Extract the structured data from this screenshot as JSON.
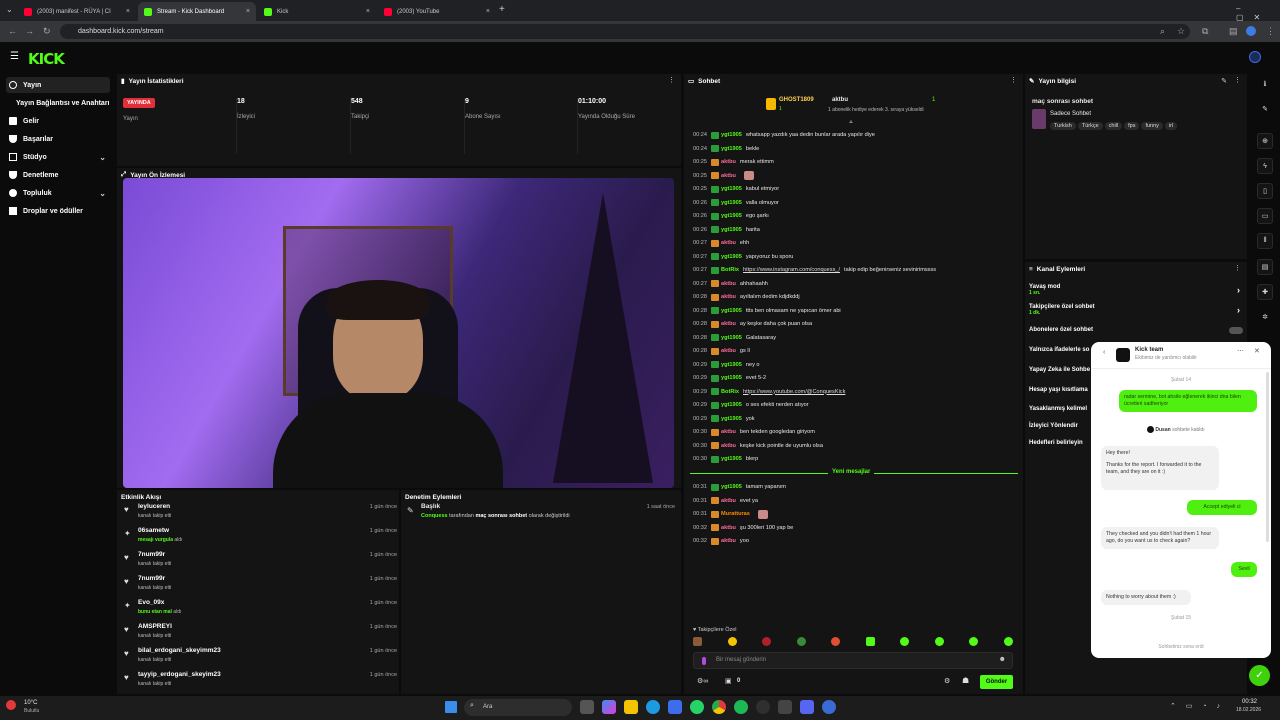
{
  "browser": {
    "tabs": [
      {
        "title": "(2003) manifest - RÜYA | CI",
        "color": "#ff0033"
      },
      {
        "title": "Stream - Kick Dashboard",
        "color": "#53fc18"
      },
      {
        "title": "Kick",
        "color": "#53fc18"
      },
      {
        "title": "(2003) YouTube",
        "color": "#ff0033"
      }
    ],
    "new_tab": "+",
    "url": "dashboard.kick.com/stream"
  },
  "logo": "KICK",
  "sidebar": {
    "items": [
      {
        "label": "Yayın",
        "icon": "broadcast-icon"
      },
      {
        "label": "Yayın Bağlantısı ve Anahtarı",
        "icon": ""
      },
      {
        "label": "Gelir",
        "icon": "money-icon"
      },
      {
        "label": "Başarılar",
        "icon": "trophy-icon"
      },
      {
        "label": "Stüdyo",
        "icon": "studio-icon",
        "chevron": "⌄"
      },
      {
        "label": "Denetleme",
        "icon": "shield-icon"
      },
      {
        "label": "Topluluk",
        "icon": "community-icon",
        "chevron": "⌄"
      },
      {
        "label": "Droplar ve ödüller",
        "icon": "gift-icon"
      }
    ]
  },
  "stats": {
    "title": "Yayın İstatistikleri",
    "live_badge": "YAYINDA",
    "items": [
      {
        "value": "",
        "label": "Yayın"
      },
      {
        "value": "18",
        "label": "İzleyici"
      },
      {
        "value": "548",
        "label": "Takipçi"
      },
      {
        "value": "9",
        "label": "Abone Sayısı"
      },
      {
        "value": "01:10:00",
        "label": "Yayında Olduğu Süre"
      }
    ]
  },
  "preview": {
    "title": "Yayın Ön İzlemesi"
  },
  "activity": {
    "title": "Etkinlik Akışı",
    "items": [
      {
        "name": "leyluceren",
        "desc": "kanalı takip etti",
        "time": "1 gün önce",
        "icon": "♥"
      },
      {
        "name": "06sametw",
        "desc": "mesajı vurgula",
        "desc2": "aldı",
        "time": "1 gün önce",
        "icon": "✦"
      },
      {
        "name": "7num99r",
        "desc": "kanalı takip etti",
        "time": "1 gün önce",
        "icon": "♥"
      },
      {
        "name": "7num99r",
        "desc": "kanalı takip etti",
        "time": "1 gün önce",
        "icon": "♥"
      },
      {
        "name": "Evo_09x",
        "desc": "bunu etan mal",
        "desc2": "aldı",
        "time": "1 gün önce",
        "icon": "✦"
      },
      {
        "name": "AMSPREYI",
        "desc": "kanalı takip etti",
        "time": "1 gün önce",
        "icon": "♥"
      },
      {
        "name": "bilal_erdogani_skeyimm23",
        "desc": "kanalı takip etti",
        "time": "1 gün önce",
        "icon": "♥"
      },
      {
        "name": "tayyip_erdogani_skeyim23",
        "desc": "kanalı takip etti",
        "time": "1 gün önce",
        "icon": "♥"
      }
    ]
  },
  "moderation": {
    "title": "Denetim Eylemleri",
    "item": {
      "title": "Başlık",
      "actor": "Conquess",
      "text1": "tarafından",
      "bold": "maç sonrası sohbet",
      "text2": "olarak değiştirildi",
      "time": "1 saat önce"
    }
  },
  "chat": {
    "title": "Sohbet",
    "gifter": "GHOST1809",
    "gifter_count": "1",
    "gift_to": "aktbu",
    "gift_count": "1",
    "gift_msg": "1 abonelik hediye ederek 3. sıraya yükseldi",
    "messages": [
      {
        "t": "00:24",
        "u": "ygt1905",
        "c": "#53fc18",
        "m": "whatsapp yazdık yaa dedin bunlar arada yapılır diye"
      },
      {
        "t": "00:24",
        "u": "ygt1905",
        "c": "#53fc18",
        "m": "bekle"
      },
      {
        "t": "00:25",
        "u": "aktbu",
        "c": "#ff6a9a",
        "m": "merak ettimm"
      },
      {
        "t": "00:25",
        "u": "aktbu",
        "c": "#ff6a9a",
        "m": ""
      },
      {
        "t": "00:25",
        "u": "ygt1905",
        "c": "#53fc18",
        "m": "kabul etmiyor"
      },
      {
        "t": "00:26",
        "u": "ygt1905",
        "c": "#53fc18",
        "m": "valla olmuyor"
      },
      {
        "t": "00:26",
        "u": "ygt1905",
        "c": "#53fc18",
        "m": "ego şarkı"
      },
      {
        "t": "00:26",
        "u": "ygt1905",
        "c": "#53fc18",
        "m": "harita"
      },
      {
        "t": "00:27",
        "u": "aktbu",
        "c": "#ff6a9a",
        "m": "ehh"
      },
      {
        "t": "00:27",
        "u": "ygt1905",
        "c": "#53fc18",
        "m": "yapıyoruz bu sporu"
      },
      {
        "t": "00:27",
        "u": "BotRix",
        "c": "#53fc18",
        "m": "https://www.instagram.com/conquess_/",
        "m2": "takip edip beğenirseniz sevinirimssss"
      },
      {
        "t": "00:27",
        "u": "aktbu",
        "c": "#ff6a9a",
        "m": "ahhahaahh"
      },
      {
        "t": "00:28",
        "u": "aktbu",
        "c": "#ff6a9a",
        "m": "ayıltalım dedim kdjdkddj"
      },
      {
        "t": "00:28",
        "u": "ygt1905",
        "c": "#53fc18",
        "m": "ttts ben olmasam ne yapıcan ömer abi"
      },
      {
        "t": "00:28",
        "u": "aktbu",
        "c": "#ff6a9a",
        "m": "ay keşke daha çok puan olsa"
      },
      {
        "t": "00:28",
        "u": "ygt1905",
        "c": "#53fc18",
        "m": "Galatasaray"
      },
      {
        "t": "00:28",
        "u": "aktbu",
        "c": "#ff6a9a",
        "m": "gs ll"
      },
      {
        "t": "00:29",
        "u": "ygt1905",
        "c": "#53fc18",
        "m": "ney o"
      },
      {
        "t": "00:29",
        "u": "ygt1905",
        "c": "#53fc18",
        "m": "evet 5-2"
      },
      {
        "t": "00:29",
        "u": "BotRix",
        "c": "#53fc18",
        "m": "https://www.youtube.com/@ConquesKick"
      },
      {
        "t": "00:29",
        "u": "ygt1905",
        "c": "#53fc18",
        "m": "o ses efekti nerden atıyor"
      },
      {
        "t": "00:29",
        "u": "ygt1905",
        "c": "#53fc18",
        "m": "yok"
      },
      {
        "t": "00:30",
        "u": "aktbu",
        "c": "#ff6a9a",
        "m": "ben tekden googledan giriyom"
      },
      {
        "t": "00:30",
        "u": "aktbu",
        "c": "#ff6a9a",
        "m": "keşke kick pointle de uyumlu olsa"
      },
      {
        "t": "00:30",
        "u": "ygt1905",
        "c": "#53fc18",
        "m": "blerp"
      }
    ],
    "new_messages": "Yeni mesajlar",
    "messages_after": [
      {
        "t": "00:31",
        "u": "ygt1905",
        "c": "#53fc18",
        "m": "tamam yapanım"
      },
      {
        "t": "00:31",
        "u": "aktbu",
        "c": "#ff6a9a",
        "m": "evet ya"
      },
      {
        "t": "00:31",
        "u": "Muratturas",
        "c": "#ff8a00",
        "m": ""
      },
      {
        "t": "00:32",
        "u": "aktbu",
        "c": "#ff6a9a",
        "m": "şu 300leri 100 yap be"
      },
      {
        "t": "00:32",
        "u": "aktbu",
        "c": "#ff6a9a",
        "m": "yoo"
      }
    ],
    "followers_only": "Takipçilere Özel",
    "input_placeholder": "Bir mesaj gönderin",
    "points": "0",
    "send": "Gönder"
  },
  "stream_info": {
    "title": "Yayın bilgisi",
    "stream_title": "maç sonrası sohbet",
    "category": "Sadece Sohbet",
    "tags": [
      "Turkish",
      "Türkçe",
      "chill",
      "fps",
      "funny",
      "irl"
    ]
  },
  "channel_actions": {
    "title": "Kanal Eylemleri",
    "items": [
      {
        "label": "Yavaş mod",
        "sub": "1 sn."
      },
      {
        "label": "Takipçilere özel sohbet",
        "sub": "1 dk."
      },
      {
        "label": "Abonelere özel sohbet",
        "sub": ""
      },
      {
        "label": "Yalnızca ifadelerle so",
        "sub": ""
      },
      {
        "label": "Yapay Zeka ile Sohbe",
        "sub": ""
      },
      {
        "label": "Hesap yaşı kısıtlama",
        "sub": ""
      },
      {
        "label": "Yasaklanmış kelimel",
        "sub": ""
      },
      {
        "label": "İzleyici Yönlendir",
        "sub": ""
      },
      {
        "label": "Hedefleri belirleyin",
        "sub": ""
      }
    ]
  },
  "support": {
    "name": "Kick team",
    "subtitle": "Ekibimiz de yardımcı olabilir",
    "date1": "Şubat 14",
    "msg1": "radar sermine, bot ahsile eğlenerek ikinci dna bilen ücretleri sadheriyor",
    "joined_name": "Dusan",
    "joined": "sohbete katıldı",
    "reply1": "Hey there!",
    "reply2": "Thanks for the report. I forwarded it to the team, and they are on it :)",
    "msg2": "Accept ediyeli ci",
    "reply3": "They checked and you didn't had them 1 hour ago, do you want us to check again?",
    "msg3": "Sevil",
    "reply4": "Nothing to worry about them :)",
    "date2": "Şubat 15",
    "footer": "Sohbetiniz sona erdi"
  },
  "taskbar": {
    "weather": "10°C",
    "weather_sub": "Bulutlu",
    "search": "Ara",
    "time": "00:32",
    "date": "18.02.2026"
  }
}
